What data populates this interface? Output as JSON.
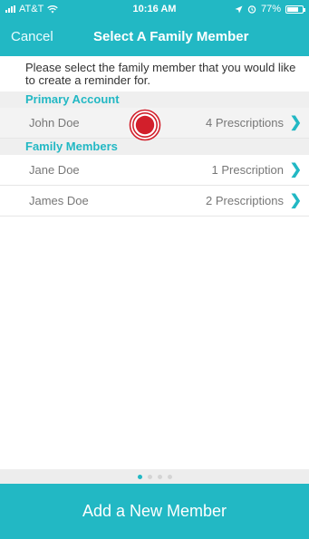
{
  "status_bar": {
    "carrier": "AT&T",
    "time": "10:16 AM",
    "battery_text": "77%",
    "battery_level": 0.77,
    "wifi_icon": "wifi-icon",
    "location_icon": "location-arrow-icon",
    "alarm_icon": "alarm-icon"
  },
  "nav": {
    "cancel_label": "Cancel",
    "title": "Select A Family Member"
  },
  "instruction": "Please select the family member that you would like to create a reminder for.",
  "primary_section": {
    "header": "Primary Account",
    "rows": [
      {
        "name": "John Doe",
        "count": "4 Prescriptions"
      }
    ]
  },
  "family_section": {
    "header": "Family Members",
    "rows": [
      {
        "name": "Jane Doe",
        "count": "1 Prescription"
      },
      {
        "name": "James Doe",
        "count": "2 Prescriptions"
      }
    ]
  },
  "page_indicator": {
    "total": 4,
    "current": 1
  },
  "add_button_label": "Add a New Member",
  "colors": {
    "accent": "#22b8c4",
    "section_bg": "#efefef",
    "tap_indicator": "#d21f2b"
  }
}
